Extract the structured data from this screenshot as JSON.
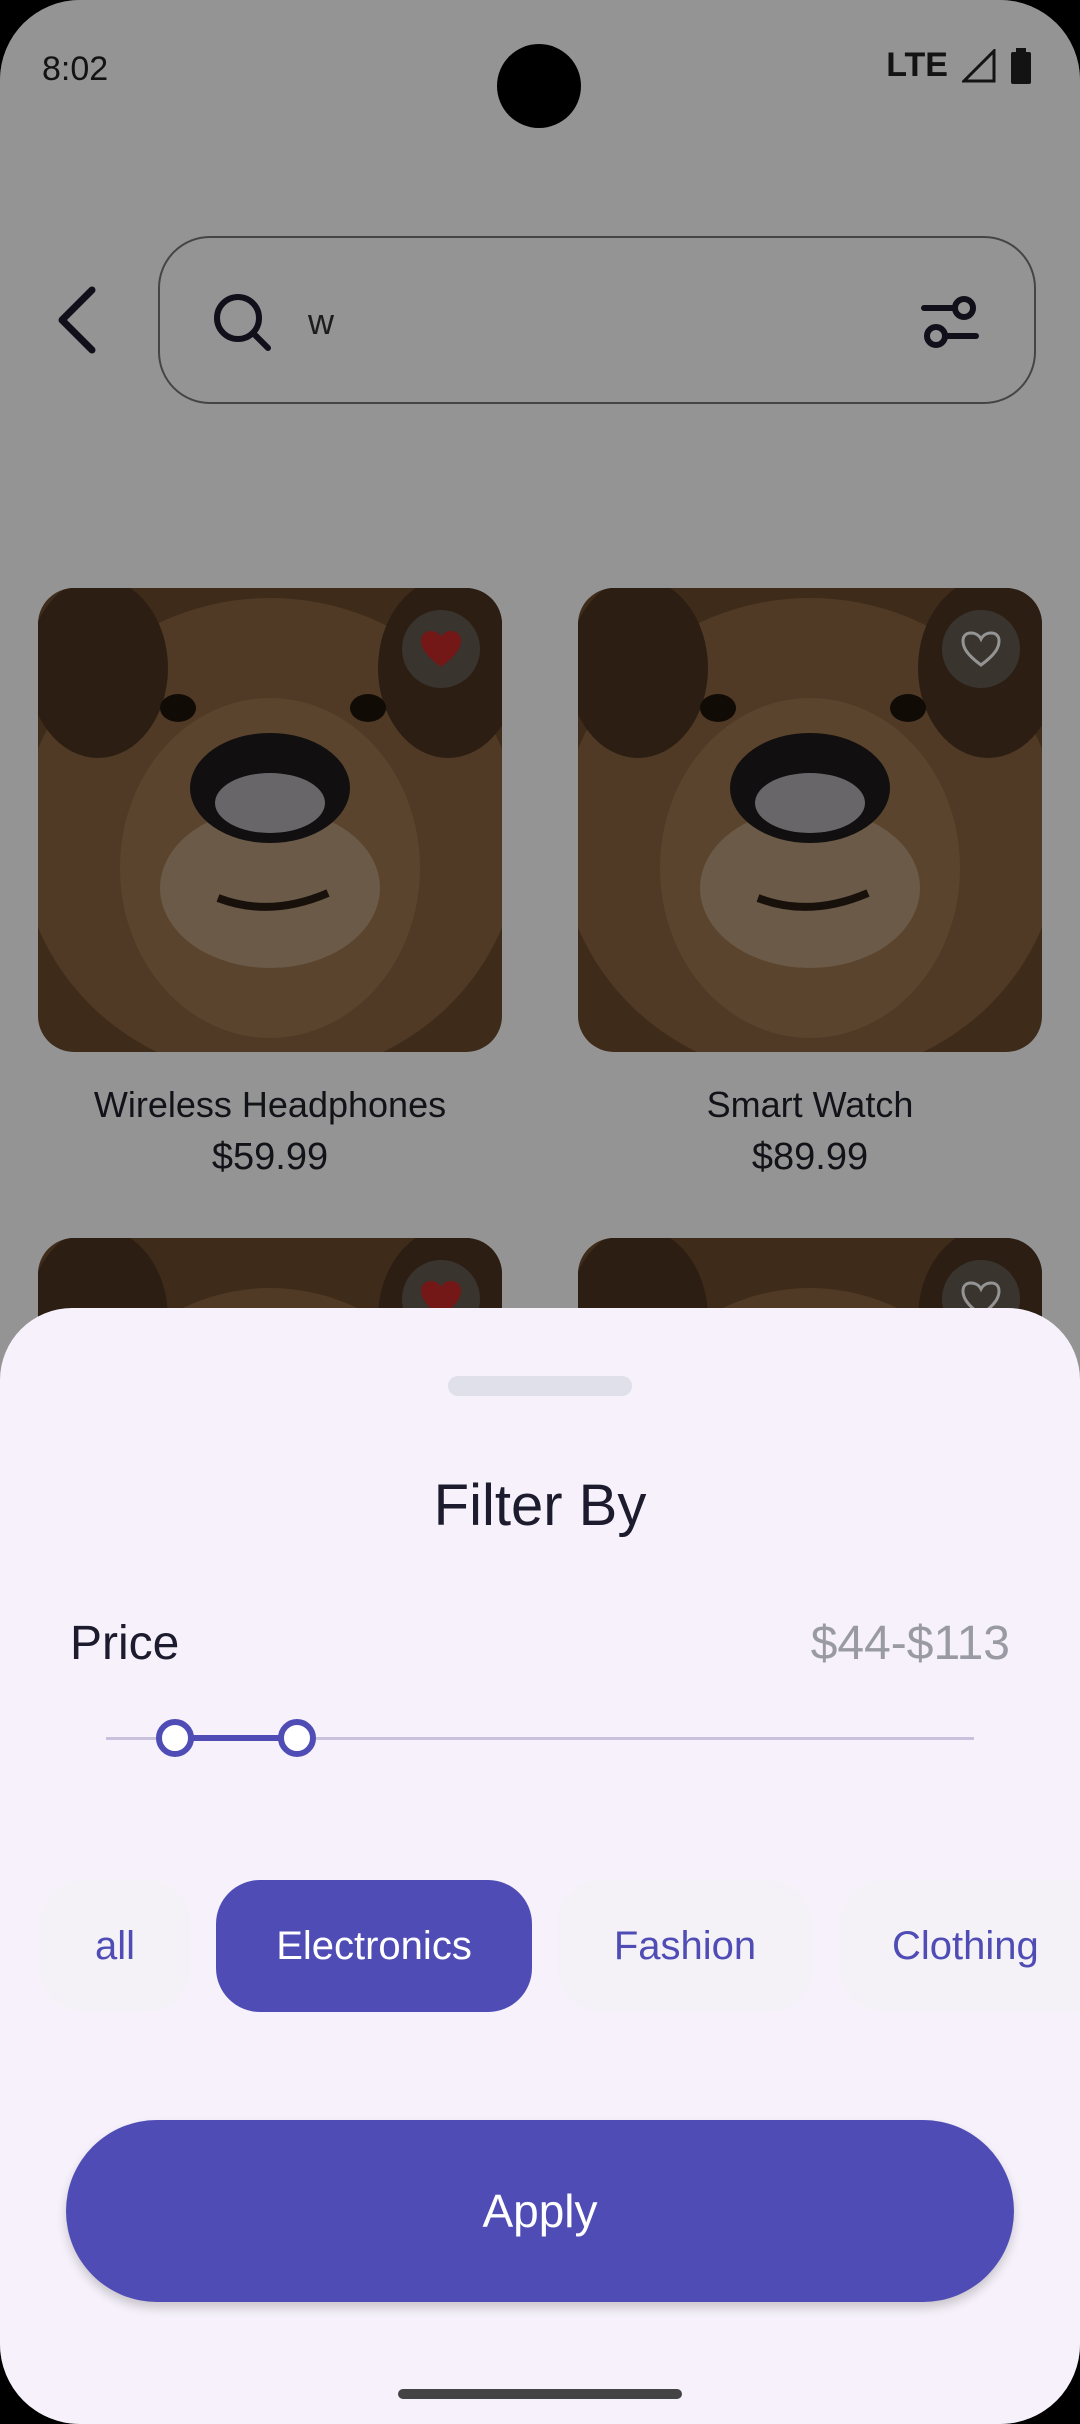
{
  "status_bar": {
    "time": "8:02",
    "network": "LTE",
    "icons": [
      "signal-icon",
      "battery-icon"
    ]
  },
  "search": {
    "value": "w",
    "icons": [
      "back-arrow-icon",
      "search-icon",
      "filter-sliders-icon"
    ]
  },
  "products": [
    {
      "name": "Wireless Headphones",
      "price": "$59.99",
      "favorited": true
    },
    {
      "name": "Smart Watch",
      "price": "$89.99",
      "favorited": false
    },
    {
      "name": "",
      "price": "",
      "favorited": true
    },
    {
      "name": "",
      "price": "",
      "favorited": false
    }
  ],
  "filter_sheet": {
    "title": "Filter By",
    "price_label": "Price",
    "price_range": "$44-$113",
    "slider": {
      "min_fraction": 0.08,
      "max_fraction": 0.22
    },
    "categories": [
      {
        "label": "all",
        "selected": false
      },
      {
        "label": "Electronics",
        "selected": true
      },
      {
        "label": "Fashion",
        "selected": false
      },
      {
        "label": "Clothing",
        "selected": false
      }
    ],
    "apply_label": "Apply"
  },
  "colors": {
    "accent": "#4f4db5",
    "sheet_background": "#f6f1fa",
    "favorite": "#c62828"
  }
}
